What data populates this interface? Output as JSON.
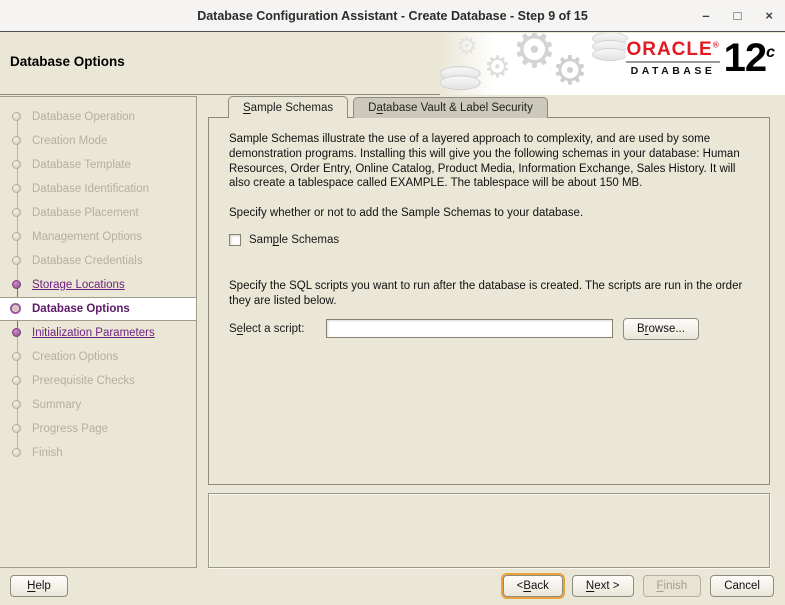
{
  "window": {
    "title": "Database Configuration Assistant - Create Database - Step 9 of 15",
    "minimize_glyph": "–",
    "maximize_glyph": "□",
    "close_glyph": "×"
  },
  "header": {
    "page_title": "Database Options",
    "logo": {
      "oracle": "ORACLE",
      "registered": "®",
      "database_word": "DATABASE",
      "version_number": "12",
      "version_letter": "c"
    }
  },
  "sidebar": {
    "steps": [
      {
        "label": "Database Operation",
        "state": "future"
      },
      {
        "label": "Creation Mode",
        "state": "future"
      },
      {
        "label": "Database Template",
        "state": "future"
      },
      {
        "label": "Database Identification",
        "state": "future"
      },
      {
        "label": "Database Placement",
        "state": "future"
      },
      {
        "label": "Management Options",
        "state": "future"
      },
      {
        "label": "Database Credentials",
        "state": "future"
      },
      {
        "label": "Storage Locations",
        "state": "visited"
      },
      {
        "label": "Database Options",
        "state": "current"
      },
      {
        "label": "Initialization Parameters",
        "state": "visited"
      },
      {
        "label": "Creation Options",
        "state": "future"
      },
      {
        "label": "Prerequisite Checks",
        "state": "future"
      },
      {
        "label": "Summary",
        "state": "future"
      },
      {
        "label": "Progress Page",
        "state": "future"
      },
      {
        "label": "Finish",
        "state": "future"
      }
    ]
  },
  "main": {
    "tabs": {
      "sample_schemas": {
        "text": "Sample Schemas",
        "mnemonic_index": 0
      },
      "database_vault": {
        "text": "Database Vault & Label Security",
        "mnemonic_index": 1
      }
    },
    "sample_schemas": {
      "description": "Sample Schemas illustrate the use of a layered approach to complexity, and are used by some demonstration programs. Installing this will give you the following schemas in your database: Human Resources, Order Entry, Online Catalog, Product Media, Information Exchange, Sales History. It will also create a tablespace called EXAMPLE. The tablespace will be about 150 MB.",
      "instruction": "Specify whether or not to add the Sample Schemas to your database.",
      "checkbox": {
        "text": "Sample Schemas",
        "mnemonic_index": 3,
        "checked": false
      },
      "scripts_description": "Specify the SQL scripts you want to run after the database is created. The scripts are run in the order they are listed below.",
      "select_label": {
        "text": "Select a script:",
        "mnemonic_index": 1
      },
      "script_input_value": "",
      "browse_button": {
        "text": "Browse...",
        "mnemonic_index": 1
      }
    }
  },
  "footer": {
    "help": {
      "text": "Help",
      "mnemonic_index": 0
    },
    "back": {
      "text": "< Back",
      "mnemonic_index": 2
    },
    "next": {
      "text": "Next >",
      "mnemonic_index": 0
    },
    "finish": {
      "text": "Finish",
      "mnemonic_index": 0
    },
    "cancel_label": "Cancel"
  },
  "colors": {
    "accent_purple": "#6d1f7f",
    "oracle_red": "#e31a22",
    "focus_orange": "#e8a33d",
    "background_cream": "#eae7d6"
  }
}
